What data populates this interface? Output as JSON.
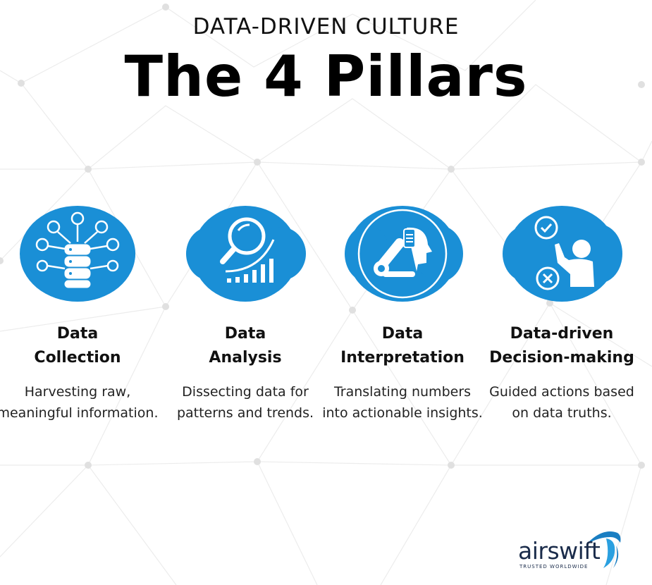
{
  "header": {
    "subtitle": "DATA-DRIVEN CULTURE",
    "title": "The 4 Pillars"
  },
  "pillars": [
    {
      "title_line1": "Data",
      "title_line2": "Collection",
      "description": "Harvesting raw, meaningful information.",
      "icon": "data-collection-icon"
    },
    {
      "title_line1": "Data",
      "title_line2": "Analysis",
      "description": "Dissecting data for patterns and trends.",
      "icon": "data-analysis-icon"
    },
    {
      "title_line1": "Data",
      "title_line2": "Interpretation",
      "description": "Translating numbers into actionable insights.",
      "icon": "data-interpretation-icon"
    },
    {
      "title_line1": "Data-driven",
      "title_line2": "Decision-making",
      "description": "Guided actions based on data truths.",
      "icon": "decision-making-icon"
    }
  ],
  "brand": {
    "name": "airswift",
    "tagline": "TRUSTED WORLDWIDE"
  },
  "colors": {
    "accent_blue": "#1a8fd6",
    "network_lines": "#e6e6e6",
    "text": "#111111",
    "logo_navy": "#1a2b4a"
  }
}
